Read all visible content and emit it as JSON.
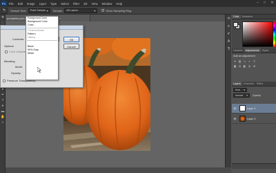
{
  "app": {
    "logo_text": "Ps"
  },
  "menubar": {
    "items": [
      "File",
      "Edit",
      "Image",
      "Layer",
      "Type",
      "Select",
      "Filter",
      "3D",
      "View",
      "Window",
      "Help"
    ],
    "window_controls": [
      "–",
      "□",
      "✕"
    ]
  },
  "options_bar": {
    "sample_size_label": "Sample Size:",
    "sample_size_value": "Point Sample",
    "sample_label": "Sample:",
    "sample_value": "All Layers",
    "show_ring_label": "Show Sampling Ring",
    "show_ring_checked": true
  },
  "document": {
    "tab_label": "pumpkins.psd @ 66.7% (Layer 1, RGB/8)"
  },
  "fill_dialog": {
    "contents_label": "Contents:",
    "contents_value": "Foreground Color",
    "options_label": "Options",
    "color_adaptation_label": "Color Adaptation",
    "blending_label": "Blending",
    "mode_label": "Mode:",
    "opacity_label": "Opacity:",
    "preserve_transparency_label": "Preserve Transparency",
    "ok_label": "OK",
    "cancel_label": "Cancel",
    "dropdown_options": [
      {
        "label": "Foreground Color",
        "dim": false
      },
      {
        "label": "Background Color",
        "dim": false
      },
      {
        "label": "Color...",
        "dim": false
      },
      {
        "label": "Content-Aware",
        "dim": true
      },
      {
        "label": "Pattern",
        "dim": false
      },
      {
        "label": "History",
        "dim": true
      },
      {
        "label": "Black",
        "dim": false
      },
      {
        "label": "50% Gray",
        "dim": false
      },
      {
        "label": "White",
        "dim": false
      }
    ]
  },
  "right_panel": {
    "top_tabs": [
      "Color",
      "Swatches"
    ],
    "adjustment_tabs": [
      "Libraries",
      "Adjustments",
      "Styles"
    ],
    "adjustment_header": "Add an adjustment",
    "layers_tabs": [
      "Layers",
      "Channels",
      "Paths"
    ],
    "layers_kind_label": "Kind",
    "layers_mode_value": "Normal",
    "layers_opacity_label": "Opacity:",
    "layers": [
      {
        "name": "Layer 1",
        "selected": true
      },
      {
        "name": "Layer 0",
        "selected": false
      }
    ]
  },
  "colors": {
    "ui_dark": "#535353",
    "pumpkin_orange": "#e0641a",
    "stem_green": "#3e4a2c"
  }
}
